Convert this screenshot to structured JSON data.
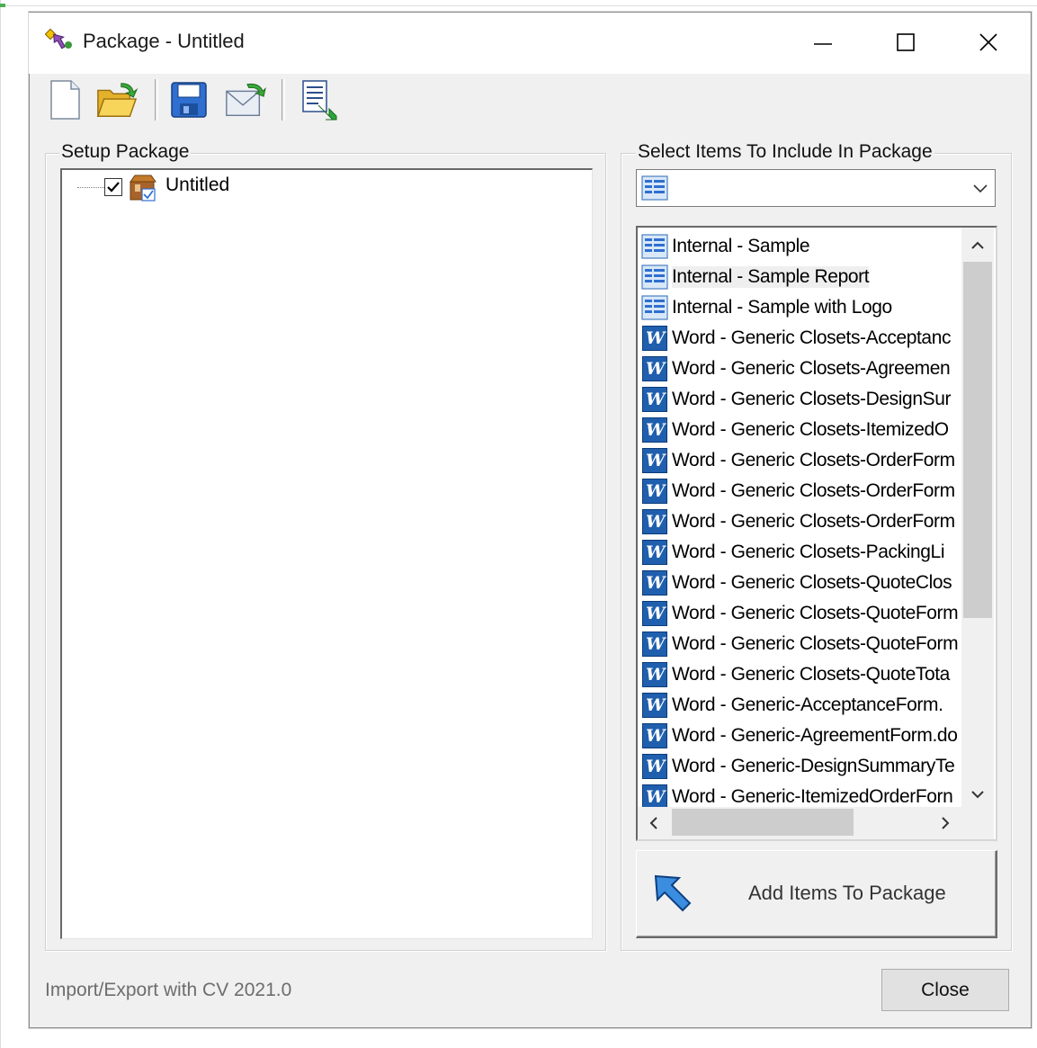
{
  "window": {
    "title": "Package - Untitled",
    "caption_buttons": {
      "minimize": "—",
      "maximize": "☐",
      "close": "✕"
    }
  },
  "toolbar": {
    "buttons": [
      {
        "name": "new",
        "icon": "new-document-icon"
      },
      {
        "name": "open",
        "icon": "open-folder-icon"
      },
      {
        "name": "save",
        "icon": "save-disk-icon"
      },
      {
        "name": "email",
        "icon": "email-envelope-icon"
      },
      {
        "name": "export",
        "icon": "export-document-icon"
      }
    ]
  },
  "setup_package": {
    "label": "Setup Package",
    "tree": [
      {
        "label": "Untitled",
        "checked": true,
        "icon": "package-box-icon"
      }
    ]
  },
  "select_items": {
    "label": "Select Items To Include In Package",
    "combo_value": "",
    "items": [
      {
        "label": "Internal - Sample",
        "type": "internal",
        "selected": false
      },
      {
        "label": "Internal - Sample Report",
        "type": "internal",
        "selected": true
      },
      {
        "label": "Internal - Sample with Logo",
        "type": "internal",
        "selected": false
      },
      {
        "label": "Word - Generic Closets-Acceptanc",
        "type": "word",
        "selected": false
      },
      {
        "label": "Word - Generic Closets-Agreemen",
        "type": "word",
        "selected": false
      },
      {
        "label": "Word - Generic Closets-DesignSur",
        "type": "word",
        "selected": false
      },
      {
        "label": "Word - Generic Closets-ItemizedO",
        "type": "word",
        "selected": false
      },
      {
        "label": "Word - Generic Closets-OrderForm",
        "type": "word",
        "selected": false
      },
      {
        "label": "Word - Generic Closets-OrderForm",
        "type": "word",
        "selected": false
      },
      {
        "label": "Word - Generic Closets-OrderForm",
        "type": "word",
        "selected": false
      },
      {
        "label": "Word - Generic Closets-PackingLi",
        "type": "word",
        "selected": false
      },
      {
        "label": "Word - Generic Closets-QuoteClos",
        "type": "word",
        "selected": false
      },
      {
        "label": "Word - Generic Closets-QuoteForm",
        "type": "word",
        "selected": false
      },
      {
        "label": "Word - Generic Closets-QuoteForm",
        "type": "word",
        "selected": false
      },
      {
        "label": "Word - Generic Closets-QuoteTota",
        "type": "word",
        "selected": false
      },
      {
        "label": "Word - Generic-AcceptanceForm.",
        "type": "word",
        "selected": false
      },
      {
        "label": "Word - Generic-AgreementForm.do",
        "type": "word",
        "selected": false
      },
      {
        "label": "Word - Generic-DesignSummaryTe",
        "type": "word",
        "selected": false
      },
      {
        "label": "Word - Generic-ItemizedOrderForn",
        "type": "word",
        "selected": false
      }
    ],
    "add_button": "Add Items To Package"
  },
  "footer": {
    "version_text": "Import/Export with CV 2021.0",
    "close_button": "Close"
  },
  "colors": {
    "window_bg": "#f0f0f0",
    "word_icon": "#1f5fae",
    "arrow_blue": "#3b8de0"
  }
}
